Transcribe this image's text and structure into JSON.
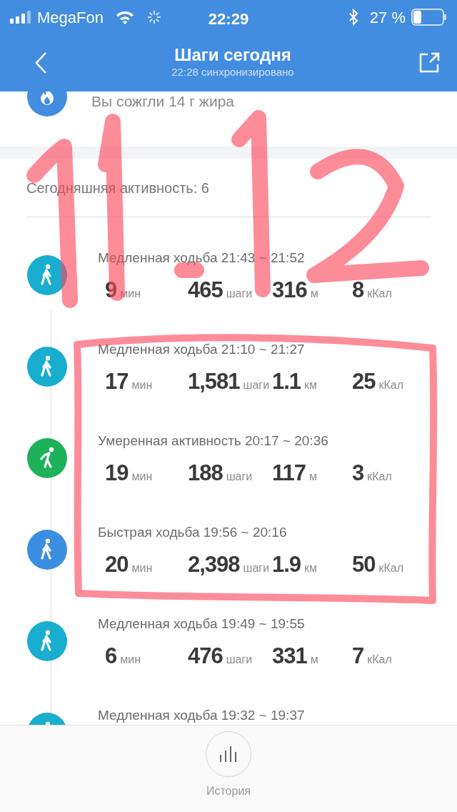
{
  "status_bar": {
    "carrier": "MegaFon",
    "time": "22:29",
    "battery": "27 %"
  },
  "header": {
    "title": "Шаги сегодня",
    "subtitle": "22:28 синхронизировано"
  },
  "fat_burned": "Вы сожгли 14 г жира",
  "activity_heading": "Сегодняшняя активность: 6",
  "activities": [
    {
      "kind": "walk",
      "color": "#19aecf",
      "title": "Медленная ходьба 21:43 ~ 21:52",
      "stats": [
        {
          "value": "9",
          "unit": "мин"
        },
        {
          "value": "465",
          "unit": "шаги"
        },
        {
          "value": "316",
          "unit": "м"
        },
        {
          "value": "8",
          "unit": "кКал"
        }
      ]
    },
    {
      "kind": "walk",
      "color": "#19aecf",
      "title": "Медленная ходьба 21:10 ~ 21:27",
      "stats": [
        {
          "value": "17",
          "unit": "мин"
        },
        {
          "value": "1,581",
          "unit": "шаги"
        },
        {
          "value": "1.1",
          "unit": "км"
        },
        {
          "value": "25",
          "unit": "кКал"
        }
      ]
    },
    {
      "kind": "moderate",
      "color": "#1db15b",
      "title": "Умеренная активность 20:17 ~ 20:36",
      "stats": [
        {
          "value": "19",
          "unit": "мин"
        },
        {
          "value": "188",
          "unit": "шаги"
        },
        {
          "value": "117",
          "unit": "м"
        },
        {
          "value": "3",
          "unit": "кКал"
        }
      ]
    },
    {
      "kind": "walk",
      "color": "#3c8ee0",
      "title": "Быстрая ходьба 19:56 ~ 20:16",
      "stats": [
        {
          "value": "20",
          "unit": "мин"
        },
        {
          "value": "2,398",
          "unit": "шаги"
        },
        {
          "value": "1.9",
          "unit": "км"
        },
        {
          "value": "50",
          "unit": "кКал"
        }
      ]
    },
    {
      "kind": "walk",
      "color": "#19aecf",
      "title": "Медленная ходьба 19:49 ~ 19:55",
      "stats": [
        {
          "value": "6",
          "unit": "мин"
        },
        {
          "value": "476",
          "unit": "шаги"
        },
        {
          "value": "331",
          "unit": "м"
        },
        {
          "value": "7",
          "unit": "кКал"
        }
      ]
    },
    {
      "kind": "walk",
      "color": "#19aecf",
      "title": "Медленная ходьба 19:32 ~ 19:37"
    }
  ],
  "footer": {
    "history_label": "История"
  }
}
